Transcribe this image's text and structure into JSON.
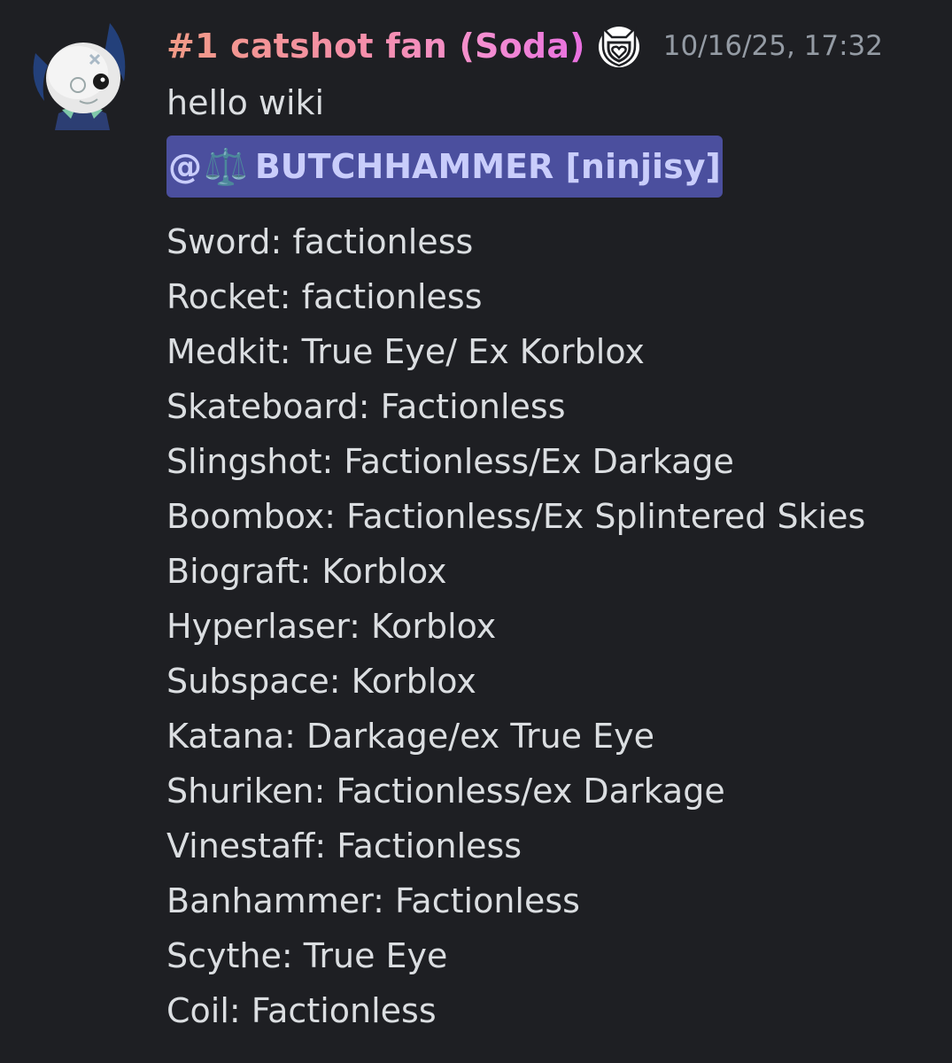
{
  "message": {
    "author": "#1 catshot fan (Soda)",
    "role_icon": "shield-heart-icon",
    "timestamp": "10/16/25, 17:32",
    "greeting": "hello wiki",
    "mention": {
      "prefix": "@",
      "icon": "⚖️",
      "name": "BUTCHHAMMER [ninjisy]"
    },
    "lines": [
      "Sword: factionless",
      "Rocket: factionless",
      "Medkit: True Eye/ Ex Korblox",
      "Skateboard: Factionless",
      "Slingshot: Factionless/Ex Darkage",
      "Boombox: Factionless/Ex Splintered Skies",
      "Biograft: Korblox",
      "Hyperlaser: Korblox",
      "Subspace: Korblox",
      "Katana: Darkage/ex True Eye",
      "Shuriken: Factionless/ex Darkage",
      "Vinestaff: Factionless",
      "Banhammer: Factionless",
      "Scythe: True Eye",
      "Coil: Factionless"
    ]
  },
  "colors": {
    "background": "#1e1f23",
    "mention_bg": "#4b4f9e",
    "timestamp": "#949ba4",
    "text": "#dbdee1"
  }
}
